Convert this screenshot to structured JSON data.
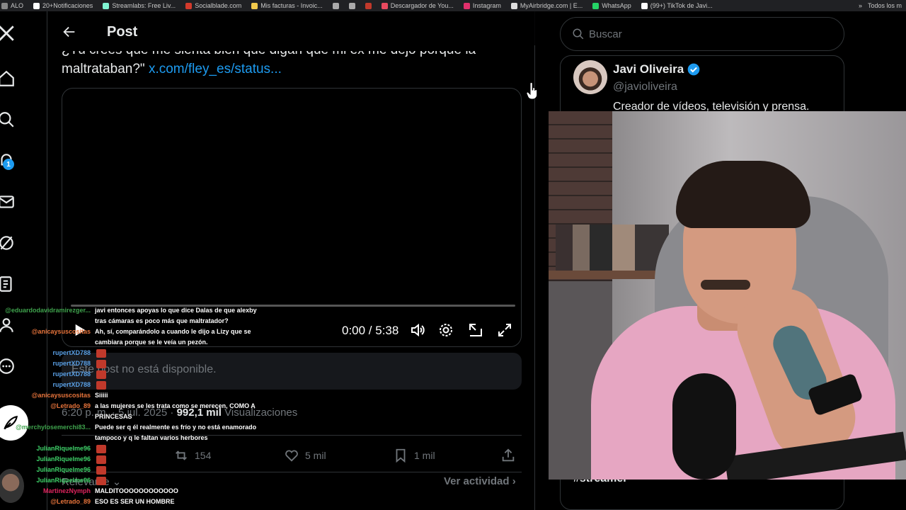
{
  "bookmarks": [
    {
      "label": "ALO",
      "color": "#888888"
    },
    {
      "label": "20+Notificaciones",
      "color": "#ffffff"
    },
    {
      "label": "Streamlabs: Free Liv...",
      "color": "#80f5d2"
    },
    {
      "label": "Socialblade.com",
      "color": "#d33a2c"
    },
    {
      "label": "Mis facturas - Invoic...",
      "color": "#f2c94c"
    },
    {
      "label": "",
      "color": "#aaaaaa"
    },
    {
      "label": "",
      "color": "#aaaaaa"
    },
    {
      "label": "",
      "color": "#c0392b"
    },
    {
      "label": "Descargador de You...",
      "color": "#e84a5f"
    },
    {
      "label": "Instagram",
      "color": "#e1306c"
    },
    {
      "label": "MyAirbridge.com | E...",
      "color": "#dddddd"
    },
    {
      "label": "WhatsApp",
      "color": "#25d366"
    },
    {
      "label": "(99+) TikTok de Javi...",
      "color": "#ffffff"
    }
  ],
  "bookmarks_right": {
    "more": "»",
    "all": "Todos los m"
  },
  "nav": {
    "notifications_badge": "1"
  },
  "header": {
    "title": "Post"
  },
  "quote": {
    "line1": "¿Tú crees que me sienta bien que digan que mi ex me dejó porque la",
    "line2_text": "maltrataban?\"",
    "link": "x.com/fley_es/status..."
  },
  "video": {
    "time": "0:00 / 5:38",
    "progress": 0.0
  },
  "unavailable": "Este post no está disponible.",
  "meta": {
    "time": "6:20 p. m.",
    "date": "· 5 jul. 2025 ·",
    "views_count": "992,1 mil",
    "views_label": "Visualizaciones"
  },
  "actions": {
    "reposts": "154",
    "likes": "5 mil",
    "bookmarks": "1 mil"
  },
  "replies": {
    "sort": "Relevante",
    "activity": "Ver actividad"
  },
  "search": {
    "placeholder": "Buscar"
  },
  "profile": {
    "name": "Javi Oliveira",
    "handle": "@javioliveira",
    "bio": "Creador de vídeos, televisión y prensa.",
    "hashtag": "#streamer"
  },
  "chat": [
    {
      "user": "@eduardodavidramirezger...",
      "color": "#3fa34d",
      "text": "javi entonces apoyas lo que dice Dalas de que alexby"
    },
    {
      "user": "",
      "color": "#3fa34d",
      "text": "tras cámaras es poco más que maltratador?"
    },
    {
      "user": "@anicaysuscositas",
      "color": "#e8743b",
      "text": "Ah, sí, comparándolo a cuando le dijo a Lizy que se"
    },
    {
      "user": "",
      "color": "#e8743b",
      "text": "cambiara porque se le veía un pezón."
    },
    {
      "user": "rupertXD788",
      "color": "#5aa0e6",
      "text": ""
    },
    {
      "user": "rupertXD788",
      "color": "#5aa0e6",
      "text": ""
    },
    {
      "user": "rupertXD788",
      "color": "#5aa0e6",
      "text": ""
    },
    {
      "user": "rupertXD788",
      "color": "#5aa0e6",
      "text": ""
    },
    {
      "user": "@anicaysuscositas",
      "color": "#e8743b",
      "text": "Siiiii"
    },
    {
      "user": "@Letrado_89",
      "color": "#e8743b",
      "text": "a las mujeres se les trata como se merecen, COMO A"
    },
    {
      "user": "",
      "color": "#e8743b",
      "text": "PRINCESAS"
    },
    {
      "user": "@merchylosemerchi83...",
      "color": "#3fa34d",
      "text": "Puede ser q él realmente es frío y no está enamorado"
    },
    {
      "user": "",
      "color": "#3fa34d",
      "text": "tampoco y q le faltan varios herbores"
    },
    {
      "user": "JulianRiquelme96",
      "color": "#3fd46a",
      "text": ""
    },
    {
      "user": "JulianRiquelme96",
      "color": "#3fd46a",
      "text": ""
    },
    {
      "user": "JulianRiquelme96",
      "color": "#3fd46a",
      "text": ""
    },
    {
      "user": "JulianRiquelme96",
      "color": "#3fd46a",
      "text": ""
    },
    {
      "user": "MartinezNymph",
      "color": "#e0245e",
      "text": "MALDITOOOOOOOOOOOO"
    },
    {
      "user": "@Letrado_89",
      "color": "#e8743b",
      "text": "ESO ES SER UN HOMBRE"
    }
  ]
}
